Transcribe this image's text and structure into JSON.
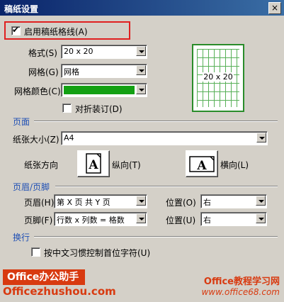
{
  "window": {
    "title": "稿纸设置",
    "close_glyph": "×"
  },
  "enable": {
    "label": "启用稿纸格线(A)",
    "checked": true
  },
  "format": {
    "style_label": "格式(S)",
    "style_value": "20 x 20",
    "grid_label": "网格(G)",
    "grid_value": "网格",
    "color_label": "网格颜色(C)",
    "color_value": "#13a013",
    "fold_label": "对折装订(D)",
    "fold_checked": false
  },
  "preview": {
    "text": "20 x 20",
    "grid_color": "#58b058",
    "border_color": "#2a8c2a"
  },
  "page": {
    "section": "页面",
    "size_label": "纸张大小(Z)",
    "size_value": "A4",
    "orient_label": "纸张方向",
    "portrait_label": "纵向(T)",
    "landscape_label": "横向(L)"
  },
  "headerfooter": {
    "section": "页眉/页脚",
    "header_label": "页眉(H)",
    "header_value": "第 X 页 共 Y 页",
    "header_pos_label": "位置(O)",
    "header_pos_value": "右",
    "footer_label": "页脚(F)",
    "footer_value": "行数 x 列数 = 格数",
    "footer_pos_label": "位置(U)",
    "footer_pos_value": "右"
  },
  "wrap": {
    "section": "换行",
    "option_label": "按中文习惯控制首位字符(U)",
    "option_checked": false
  },
  "watermark": {
    "left_top": "Office办公助手",
    "left_bottom": "Officezhushou.com",
    "right_top": "Office教程学习网",
    "right_bottom": "www.office68.com"
  }
}
